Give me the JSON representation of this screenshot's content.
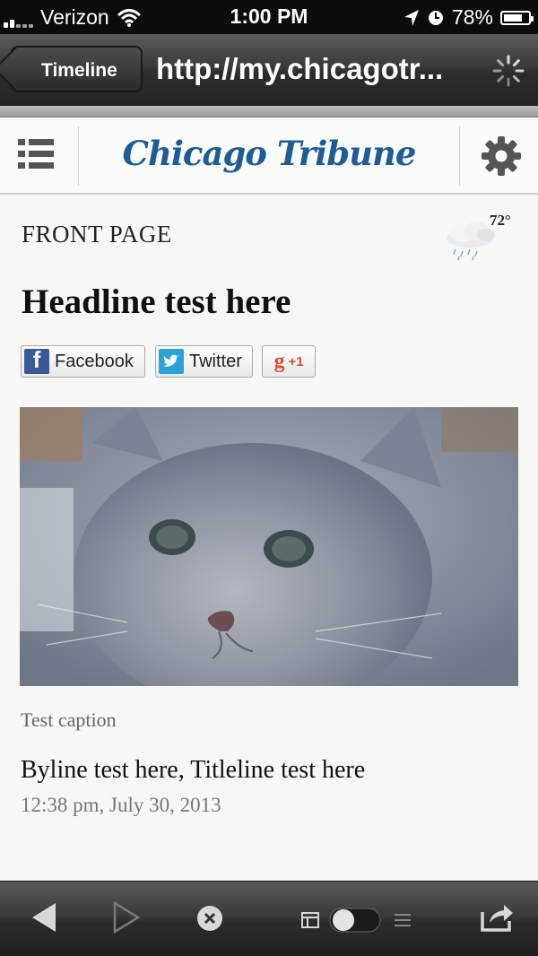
{
  "status_bar": {
    "carrier": "Verizon",
    "time": "1:00 PM",
    "battery": "78%",
    "battery_level": 0.78
  },
  "nav_bar": {
    "back_label": "Timeline",
    "url": "http://my.chicagotr..."
  },
  "site": {
    "logo": "Chicago Tribune"
  },
  "weather": {
    "temperature": "72°",
    "icon": "rain-cloud-icon"
  },
  "article": {
    "section": "FRONT PAGE",
    "headline": "Headline test here",
    "share": {
      "facebook": "Facebook",
      "twitter": "Twitter",
      "gplus_g": "g",
      "gplus": "+1"
    },
    "image_alt": "kitten photo",
    "caption": "Test caption",
    "byline": "Byline test here, Titleline test here",
    "timestamp": "12:38 pm, July 30, 2013"
  },
  "toolbar": {
    "icons": [
      "back-arrow-icon",
      "forward-arrow-icon",
      "stop-icon",
      "reader-toggle-icon",
      "share-icon"
    ]
  },
  "colors": {
    "logo": "#1e5c96",
    "facebook": "#3b5998",
    "twitter": "#2aa3d9",
    "gplus": "#dd4b39"
  }
}
